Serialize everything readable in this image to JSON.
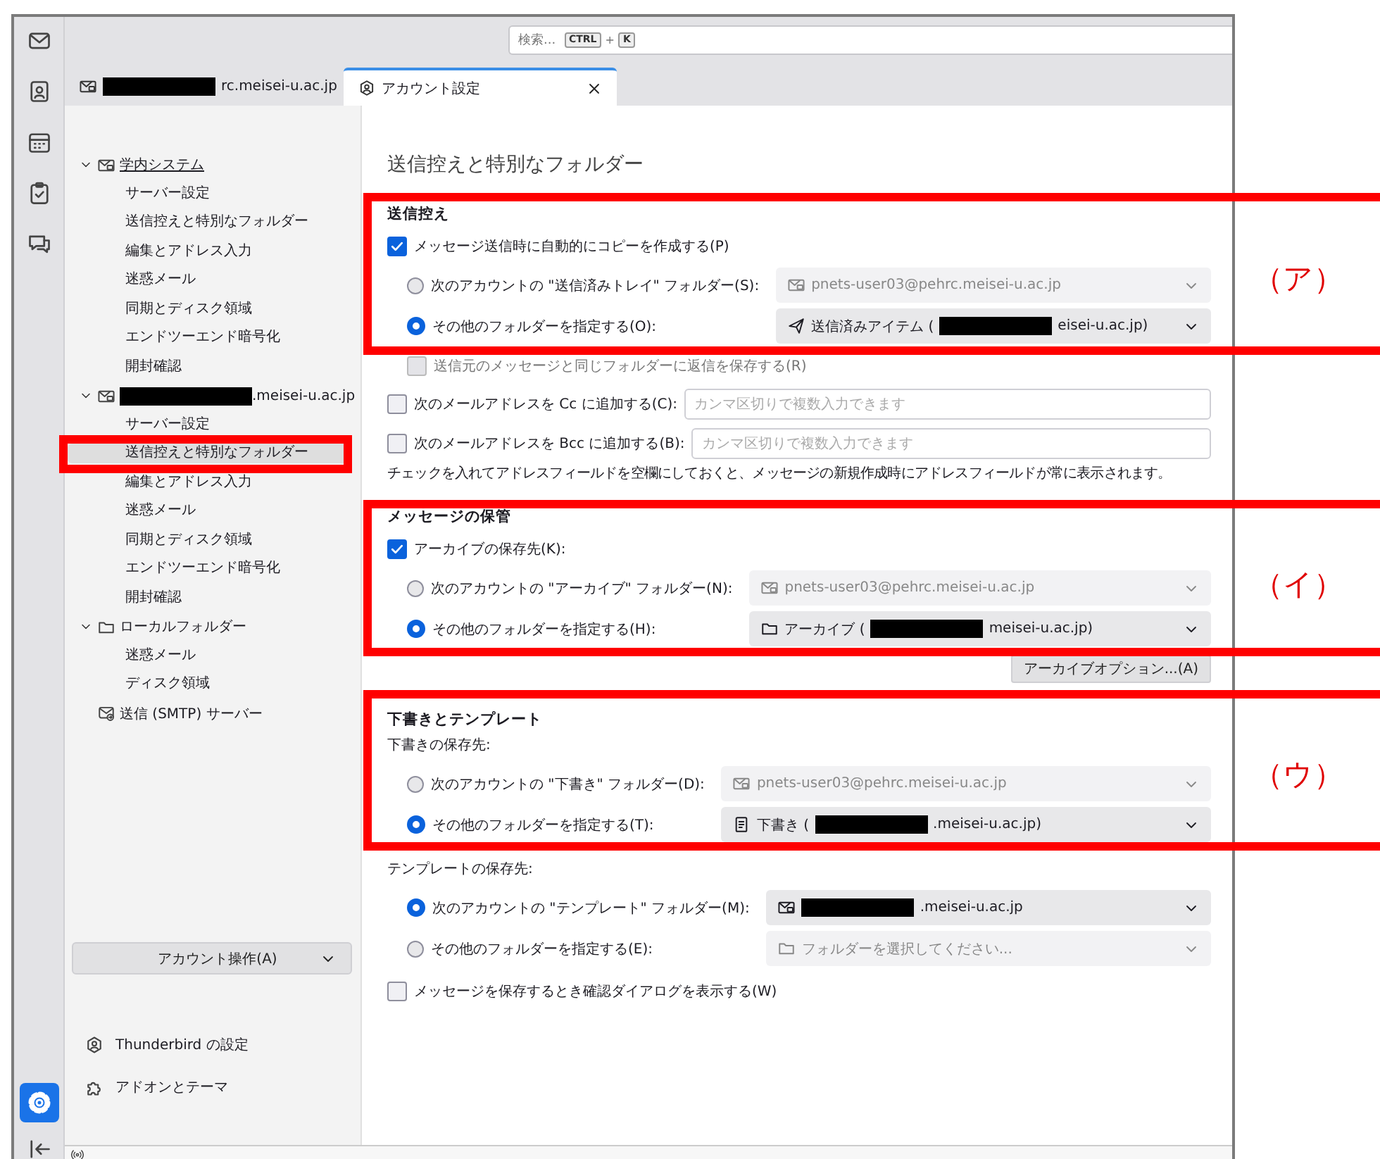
{
  "spaces_toolbar": {
    "buttons": [
      {
        "selected": false
      },
      {
        "selected": false
      },
      {
        "selected": false
      },
      {
        "selected": false
      },
      {
        "selected": false
      }
    ],
    "bottom_buttons": [
      {
        "selected": true
      },
      {
        "selected": false
      }
    ]
  },
  "search": {
    "placeholder": "検索...",
    "keys": [
      "CTRL",
      "+",
      "K"
    ]
  },
  "tabs": [
    {
      "kind": "account",
      "selected": false,
      "closable": false,
      "parts": [
        {
          "kind": "redaction"
        },
        {
          "kind": "text",
          "text": "rc.meisei-u.ac.jp"
        }
      ]
    },
    {
      "kind": "settings",
      "selected": true,
      "closable": true,
      "parts": [
        {
          "kind": "text",
          "text": "アカウント設定"
        }
      ]
    }
  ],
  "sidebar": {
    "tree": [
      {
        "kind": "account",
        "focused": true,
        "expanded": true,
        "parts": [
          {
            "kind": "text",
            "text": "学内システム"
          }
        ],
        "children": [
          {
            "label": "サーバー設定",
            "selected": false
          },
          {
            "label": "送信控えと特別なフォルダー",
            "selected": false
          },
          {
            "label": "編集とアドレス入力",
            "selected": false
          },
          {
            "label": "迷惑メール",
            "selected": false
          },
          {
            "label": "同期とディスク領域",
            "selected": false
          },
          {
            "label": "エンドツーエンド暗号化",
            "selected": false
          },
          {
            "label": "開封確認",
            "selected": false
          }
        ]
      },
      {
        "kind": "account",
        "focused": false,
        "expanded": true,
        "parts": [
          {
            "kind": "redaction"
          },
          {
            "kind": "text",
            "text": ".meisei-u.ac.jp"
          }
        ],
        "children": [
          {
            "label": "サーバー設定",
            "selected": false
          },
          {
            "label": "送信控えと特別なフォルダー",
            "selected": true
          },
          {
            "label": "編集とアドレス入力",
            "selected": false
          },
          {
            "label": "迷惑メール",
            "selected": false
          },
          {
            "label": "同期とディスク領域",
            "selected": false
          },
          {
            "label": "エンドツーエンド暗号化",
            "selected": false
          },
          {
            "label": "開封確認",
            "selected": false
          }
        ]
      },
      {
        "kind": "local",
        "focused": false,
        "expanded": true,
        "parts": [
          {
            "kind": "text",
            "text": "ローカルフォルダー"
          }
        ],
        "children": [
          {
            "label": "迷惑メール",
            "selected": false
          },
          {
            "label": "ディスク領域",
            "selected": false
          }
        ]
      },
      {
        "kind": "smtp",
        "focused": false,
        "parts": [
          {
            "kind": "text",
            "text": "送信 (SMTP) サーバー"
          }
        ]
      }
    ],
    "account_actions": "アカウント操作(A)",
    "links": [
      {
        "kind": "settings",
        "label": "Thunderbird の設定"
      },
      {
        "kind": "addons",
        "label": "アドオンとテーマ"
      }
    ]
  },
  "main": {
    "title": "送信控えと特別なフォルダー",
    "sections": [
      {
        "heading": "送信控え",
        "items": [
          {
            "kind": "checkbox",
            "label": "メッセージ送信時に自動的にコピーを作成する(P)",
            "checked": true,
            "disabled": false
          },
          {
            "kind": "radio_group",
            "options": [
              {
                "label": "次のアカウントの \"送信済みトレイ\" フォルダー(S):",
                "selected": false,
                "dropdown": {
                  "kind": "account",
                  "disabled": true,
                  "parts": [
                    {
                      "kind": "text",
                      "text": "pnets-user03@pehrc.meisei-u.ac.jp"
                    }
                  ]
                }
              },
              {
                "label": "その他のフォルダーを指定する(O):",
                "selected": true,
                "dropdown": {
                  "kind": "sent",
                  "disabled": false,
                  "parts": [
                    {
                      "kind": "text",
                      "text": "送信済みアイテム ("
                    },
                    {
                      "kind": "redaction"
                    },
                    {
                      "kind": "text",
                      "text": "eisei-u.ac.jp)"
                    }
                  ]
                }
              }
            ]
          },
          {
            "kind": "subcheckbox",
            "label": "送信元のメッセージと同じフォルダーに返信を保存する(R)",
            "checked": false,
            "disabled": true
          },
          {
            "kind": "checkbox_field",
            "label": "次のメールアドレスを Cc に追加する(C):",
            "checked": false,
            "placeholder": "カンマ区切りで複数入力できます"
          },
          {
            "kind": "checkbox_field",
            "label": "次のメールアドレスを Bcc に追加する(B):",
            "checked": false,
            "placeholder": "カンマ区切りで複数入力できます"
          },
          {
            "kind": "note",
            "text": "チェックを入れてアドレスフィールドを空欄にしておくと、メッセージの新規作成時にアドレスフィールドが常に表示されます。"
          }
        ]
      },
      {
        "heading": "メッセージの保管",
        "items": [
          {
            "kind": "checkbox",
            "label": "アーカイブの保存先(K):",
            "checked": true,
            "disabled": false
          },
          {
            "kind": "radio_group",
            "options": [
              {
                "label": "次のアカウントの \"アーカイブ\" フォルダー(N):",
                "selected": false,
                "dropdown": {
                  "kind": "account",
                  "disabled": true,
                  "parts": [
                    {
                      "kind": "text",
                      "text": "pnets-user03@pehrc.meisei-u.ac.jp"
                    }
                  ]
                }
              },
              {
                "label": "その他のフォルダーを指定する(H):",
                "selected": true,
                "dropdown": {
                  "kind": "folder",
                  "disabled": false,
                  "parts": [
                    {
                      "kind": "text",
                      "text": "アーカイブ ("
                    },
                    {
                      "kind": "redaction"
                    },
                    {
                      "kind": "text",
                      "text": "meisei-u.ac.jp)"
                    }
                  ]
                }
              }
            ]
          },
          {
            "kind": "button",
            "label": "アーカイブオプション...(A)"
          }
        ]
      },
      {
        "heading": "下書きとテンプレート",
        "items": [
          {
            "kind": "sublabel",
            "text": "下書きの保存先:"
          },
          {
            "kind": "radio_group",
            "options": [
              {
                "label": "次のアカウントの \"下書き\" フォルダー(D):",
                "selected": false,
                "dropdown": {
                  "kind": "account",
                  "disabled": true,
                  "parts": [
                    {
                      "kind": "text",
                      "text": "pnets-user03@pehrc.meisei-u.ac.jp"
                    }
                  ]
                }
              },
              {
                "label": "その他のフォルダーを指定する(T):",
                "selected": true,
                "dropdown": {
                  "kind": "draft",
                  "disabled": false,
                  "parts": [
                    {
                      "kind": "text",
                      "text": "下書き ("
                    },
                    {
                      "kind": "redaction"
                    },
                    {
                      "kind": "text",
                      "text": ".meisei-u.ac.jp)"
                    }
                  ]
                }
              }
            ]
          },
          {
            "kind": "sublabel",
            "text": "テンプレートの保存先:"
          },
          {
            "kind": "radio_group",
            "options": [
              {
                "label": "次のアカウントの \"テンプレート\" フォルダー(M):",
                "selected": true,
                "dropdown": {
                  "kind": "account",
                  "disabled": false,
                  "parts": [
                    {
                      "kind": "redaction"
                    },
                    {
                      "kind": "text",
                      "text": ".meisei-u.ac.jp"
                    }
                  ]
                }
              },
              {
                "label": "その他のフォルダーを指定する(E):",
                "selected": false,
                "dropdown": {
                  "kind": "folder",
                  "disabled": true,
                  "parts": [
                    {
                      "kind": "text",
                      "text": "フォルダーを選択してください..."
                    }
                  ]
                }
              }
            ]
          },
          {
            "kind": "checkbox",
            "label": "メッセージを保存するとき確認ダイアログを表示する(W)",
            "checked": false,
            "disabled": false
          }
        ]
      }
    ]
  },
  "annotations": [
    {
      "kind": "labeled_box",
      "label": "（ア）"
    },
    {
      "kind": "labeled_box",
      "label": "（イ）"
    },
    {
      "kind": "labeled_box",
      "label": "（ウ）"
    },
    {
      "kind": "box"
    }
  ]
}
